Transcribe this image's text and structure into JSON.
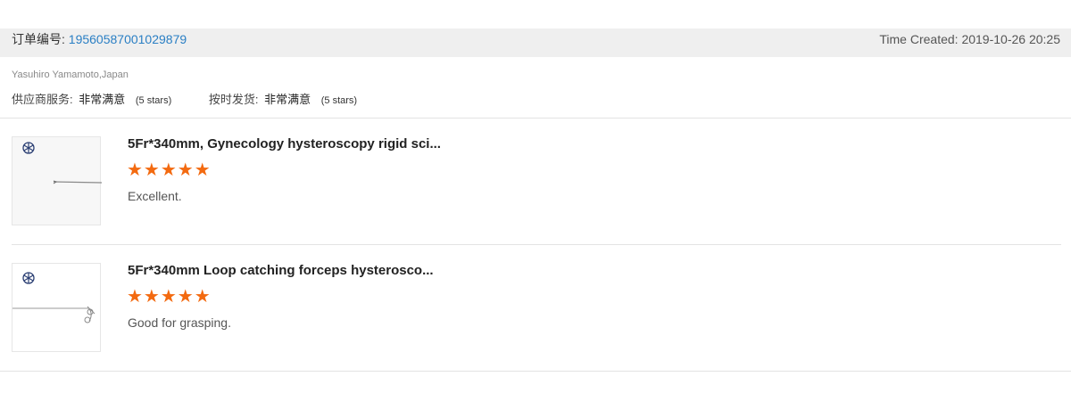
{
  "order": {
    "label": "订单编号:",
    "number": "19560587001029879",
    "time_label": "Time Created:",
    "time_value": "2019-10-26 20:25"
  },
  "buyer": {
    "name": "Yasuhiro Yamamoto,Japan"
  },
  "ratings": [
    {
      "label": "供应商服务:",
      "value": "非常满意",
      "stars_text": "(5 stars)",
      "stars": 5
    },
    {
      "label": "按时发货:",
      "value": "非常满意",
      "stars_text": "(5 stars)",
      "stars": 5
    }
  ],
  "products": [
    {
      "title": "5Fr*340mm, Gynecology hysteroscopy rigid sci...",
      "rating": 5,
      "stars_glyphs": "★★★★★",
      "review": "Excellent."
    },
    {
      "title": "5Fr*340mm Loop catching forceps hysterosco...",
      "rating": 5,
      "stars_glyphs": "★★★★★",
      "review": "Good for grasping."
    }
  ],
  "colors": {
    "order_number": "#2a7fc4",
    "star": "#f36a10",
    "header_bg": "#efefef"
  }
}
